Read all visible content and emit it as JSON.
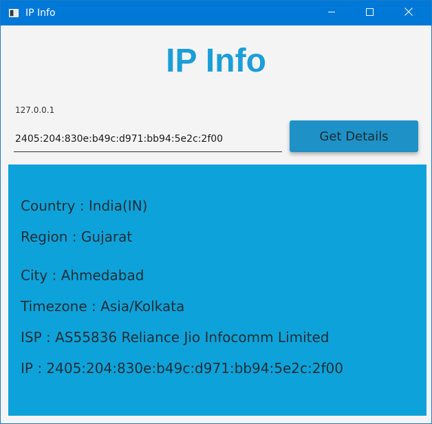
{
  "window": {
    "title": "IP Info",
    "icon": "app-window-icon",
    "controls": [
      "minimize-icon",
      "maximize-icon",
      "close-icon"
    ]
  },
  "heading": "IP Info",
  "input": {
    "label": "127.0.0.1",
    "value": "2405:204:830e:b49c:d971:bb94:5e2c:2f00"
  },
  "button": {
    "label": "Get Details"
  },
  "details": {
    "country": "Country : India(IN)",
    "region": "Region : Gujarat",
    "city": "City : Ahmedabad",
    "timezone": "Timezone : Asia/Kolkata",
    "isp": "ISP : AS55836 Reliance Jio Infocomm Limited",
    "ip": "IP : 2405:204:830e:b49c:d971:bb94:5e2c:2f00"
  },
  "colors": {
    "titlebar": "#0078d7",
    "heading": "#1b9ed8",
    "button": "#1e91c6",
    "panel": "#0da3da",
    "background": "#f4f4f4"
  }
}
